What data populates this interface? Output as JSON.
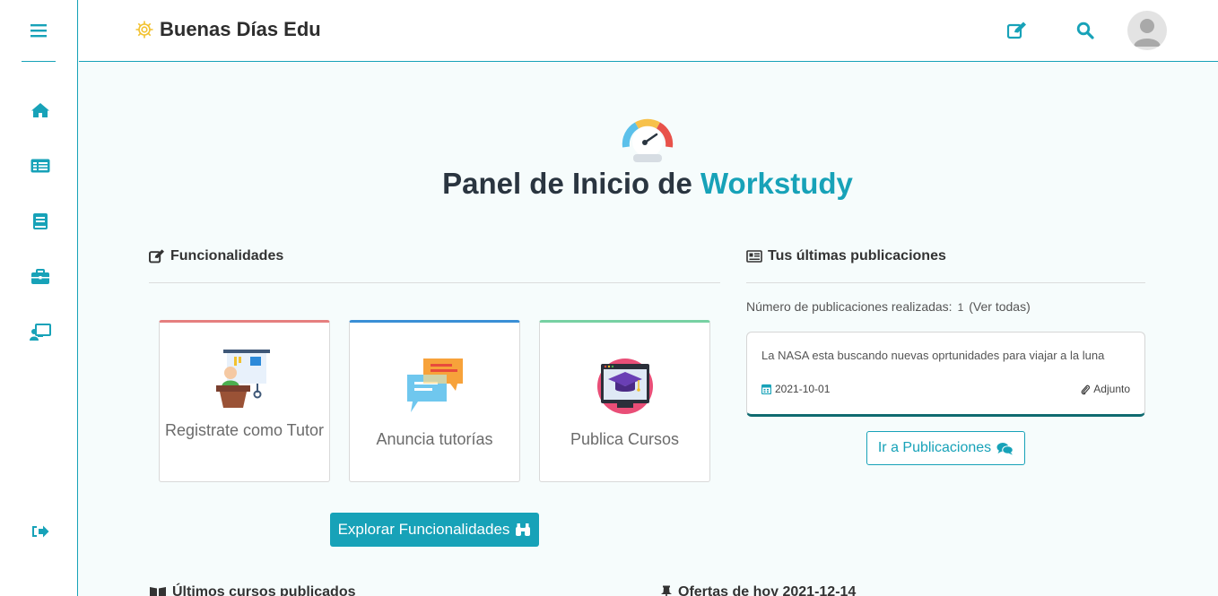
{
  "colors": {
    "accent": "#17a2b8",
    "dark": "#2a3540",
    "card_tutor": "#e57f7f",
    "card_tutorias": "#3a8fd6",
    "card_cursos": "#77d1a3"
  },
  "sidebar": {
    "menu_icon": "hamburger-icon",
    "items": [
      {
        "name": "home",
        "icon": "home-icon"
      },
      {
        "name": "publications",
        "icon": "list-icon"
      },
      {
        "name": "courses",
        "icon": "book-icon"
      },
      {
        "name": "offers",
        "icon": "briefcase-icon"
      },
      {
        "name": "tutoring",
        "icon": "teacher-icon"
      }
    ],
    "logout_icon": "sign-out-icon"
  },
  "header": {
    "brand": "Buenas Días Edu",
    "edit_icon": "edit-icon",
    "search_icon": "search-icon",
    "avatar_icon": "user-avatar-icon"
  },
  "main": {
    "title_prefix": "Panel de Inicio de",
    "title_accent": "Workstudy",
    "features": {
      "title": "Funcionalidades",
      "cards": [
        {
          "label": "Registrate como Tutor"
        },
        {
          "label": "Anuncia tutorías"
        },
        {
          "label": "Publica Cursos"
        }
      ],
      "explore_button": "Explorar Funcionalidades"
    },
    "publications": {
      "title": "Tus últimas publicaciones",
      "count_label": "Número de publicaciones realizadas:",
      "count": "1",
      "view_all": "(Ver todas)",
      "latest": {
        "text": "La NASA esta buscando nuevas oprtunidades para viajar a la luna",
        "date": "2021-10-01",
        "attachment": "Adjunto"
      },
      "go_button": "Ir a Publicaciones"
    },
    "bottom_sections": {
      "courses": "Últimos cursos publicados",
      "offers": "Ofertas de hoy 2021-12-14"
    }
  }
}
